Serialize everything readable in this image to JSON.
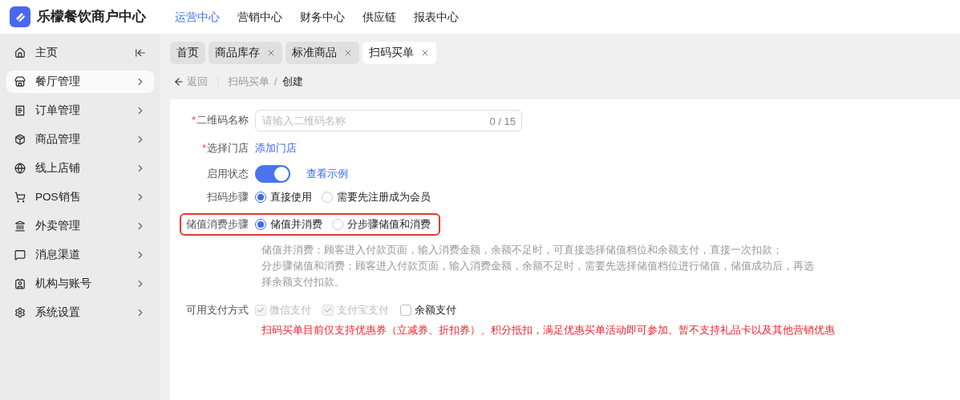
{
  "brand": {
    "name": "乐檬餐饮商户中心"
  },
  "top_nav": [
    {
      "label": "运营中心",
      "selected": true
    },
    {
      "label": "营销中心",
      "selected": false
    },
    {
      "label": "财务中心",
      "selected": false
    },
    {
      "label": "供应链",
      "selected": false
    },
    {
      "label": "报表中心",
      "selected": false
    }
  ],
  "sidebar": {
    "items": [
      {
        "label": "主页",
        "kind": "collapse",
        "selected": false
      },
      {
        "label": "餐厅管理",
        "kind": "menu",
        "selected": true
      },
      {
        "label": "订单管理",
        "kind": "menu",
        "selected": false
      },
      {
        "label": "商品管理",
        "kind": "menu",
        "selected": false
      },
      {
        "label": "线上店铺",
        "kind": "menu",
        "selected": false
      },
      {
        "label": "POS销售",
        "kind": "menu",
        "selected": false
      },
      {
        "label": "外卖管理",
        "kind": "menu",
        "selected": false
      },
      {
        "label": "消息渠道",
        "kind": "menu",
        "selected": false
      },
      {
        "label": "机构与账号",
        "kind": "menu",
        "selected": false
      },
      {
        "label": "系统设置",
        "kind": "menu",
        "selected": false
      }
    ]
  },
  "tabs": [
    {
      "label": "首页",
      "closable": false,
      "selected": false
    },
    {
      "label": "商品库存",
      "closable": true,
      "selected": false
    },
    {
      "label": "标准商品",
      "closable": true,
      "selected": false
    },
    {
      "label": "扫码买单",
      "closable": true,
      "selected": true
    }
  ],
  "breadcrumb": {
    "back": "返回",
    "items": [
      "扫码买单",
      "创建"
    ],
    "separator": "/"
  },
  "form": {
    "fields": [
      {
        "kind": "input",
        "label": "二维码名称",
        "required_mark": "*",
        "placeholder": "请输入二维码名称",
        "counter": "0 / 15"
      },
      {
        "kind": "link",
        "label": "选择门店",
        "required_mark": "*",
        "link": "添加门店"
      },
      {
        "kind": "switch",
        "label": "启用状态",
        "on": true,
        "link": "查看示例"
      },
      {
        "kind": "radio",
        "label": "扫码步骤",
        "highlighted": false,
        "options": [
          {
            "label": "直接使用",
            "selected": true
          },
          {
            "label": "需要先注册成为会员",
            "selected": false
          }
        ]
      },
      {
        "kind": "radio",
        "label": "储值消费步骤",
        "highlighted": true,
        "options": [
          {
            "label": "储值并消费",
            "selected": true
          },
          {
            "label": "分步骤储值和消费",
            "selected": false
          }
        ],
        "help": [
          "储值并消费：顾客进入付款页面，输入消费金额，余额不足时，可直接选择储值档位和余额支付，直接一次扣款；",
          "分步骤储值和消费：顾客进入付款页面，输入消费金额，余额不足时，需要先选择储值档位进行储值，储值成功后，再选择余额支付扣款。"
        ]
      },
      {
        "kind": "checkbox",
        "label": "可用支付方式",
        "options": [
          {
            "label": "微信支付",
            "checked": true,
            "disabled": true
          },
          {
            "label": "支付宝支付",
            "checked": true,
            "disabled": true
          },
          {
            "label": "余额支付",
            "checked": false,
            "disabled": false
          }
        ],
        "warning": "扫码买单目前仅支持优惠券（立减券、折扣券）、积分抵扣，满足优惠买单活动即可参加。暂不支持礼品卡以及其他营销优惠"
      }
    ]
  }
}
